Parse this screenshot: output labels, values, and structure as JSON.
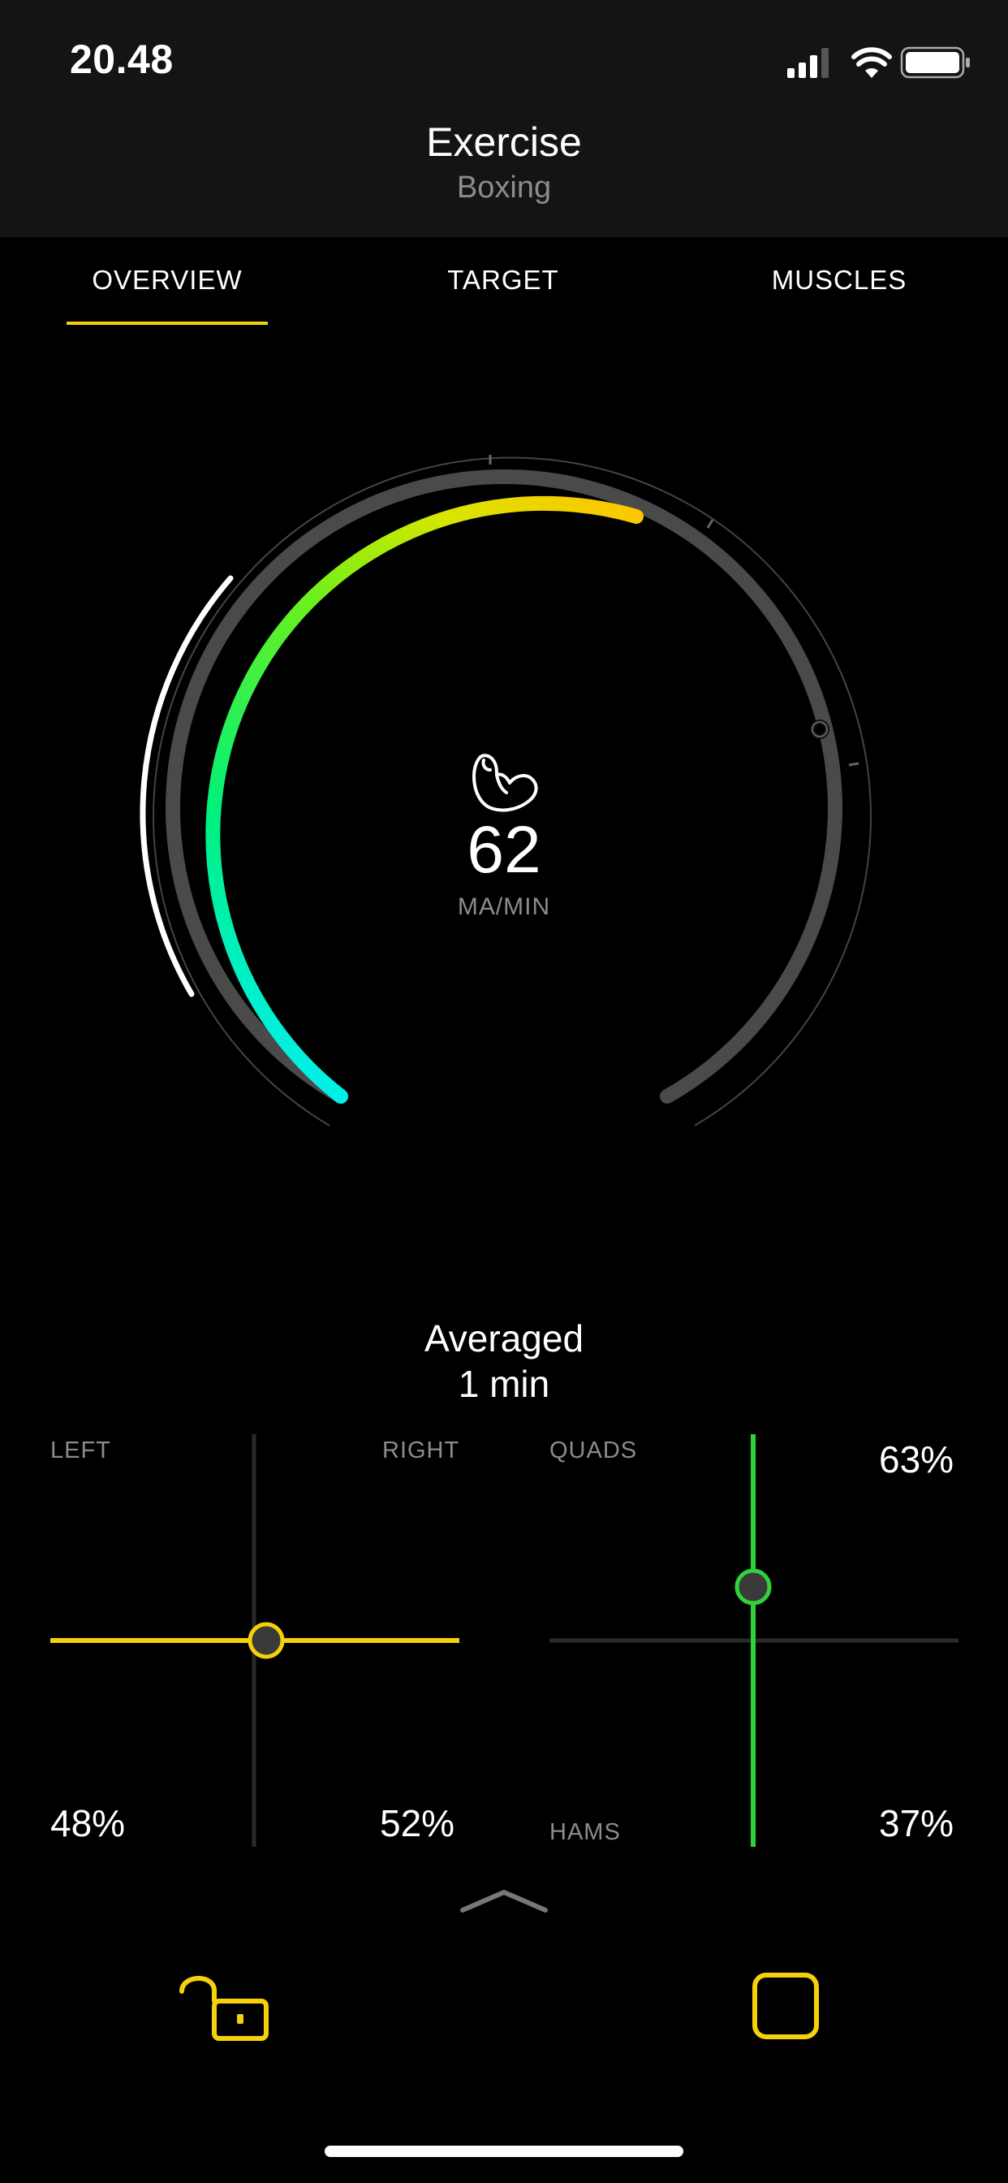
{
  "status_bar": {
    "time": "20.48",
    "icons": [
      "signal-icon",
      "wifi-icon",
      "battery-icon"
    ]
  },
  "header": {
    "title": "Exercise",
    "subtitle": "Boxing"
  },
  "tabs": [
    {
      "label": "OVERVIEW",
      "active": true
    },
    {
      "label": "TARGET",
      "active": false
    },
    {
      "label": "MUSCLES",
      "active": false
    }
  ],
  "gauge": {
    "icon": "flexed-bicep-icon",
    "value": "62",
    "unit": "MA/MIN"
  },
  "averaged": {
    "line1": "Averaged",
    "line2": "1 min"
  },
  "left_right_panel": {
    "left_label": "LEFT",
    "right_label": "RIGHT",
    "left_value": "48%",
    "right_value": "52%",
    "balance_fraction": 0.52
  },
  "quads_hams_panel": {
    "top_label": "QUADS",
    "bottom_label": "HAMS",
    "top_value": "63%",
    "bottom_value": "37%",
    "balance_fraction": 0.63
  },
  "bottom_toolbar": {
    "lock_icon": "unlocked-padlock-icon",
    "stop_icon": "stop-square-icon",
    "expand_icon": "chevron-up-icon"
  },
  "colors": {
    "accent": "#f5d10a",
    "green_marker": "#2ed33a",
    "gauge_track": "#4a4a4a"
  }
}
